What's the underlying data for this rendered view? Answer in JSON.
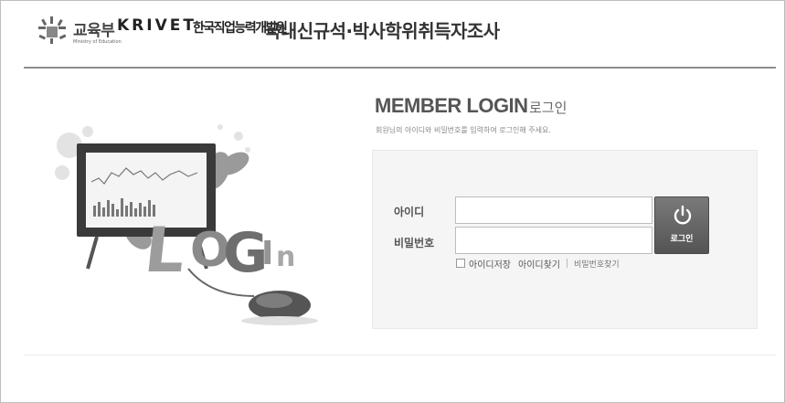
{
  "header": {
    "ministry_name": "교육부",
    "ministry_en": "Ministry of Education",
    "krivet_logo": "KRIVET",
    "krivet_kr": "한국직업능력개발원",
    "survey_title": "국내신규석·박사학위취득자조사"
  },
  "illustration": {
    "word": "LOGIN"
  },
  "login": {
    "title": "MEMBER LOGIN",
    "title_kr": "로그인",
    "description": "회원님의 아이디와 비밀번호를 입력하여 로그인해 주세요.",
    "id_label": "아이디",
    "pw_label": "비밀번호",
    "id_value": "",
    "pw_value": "",
    "button_label": "로그인",
    "save_id_label": "아이디저장",
    "find_id_label": "아이디찾기",
    "find_pw_label": "비밀번호찾기"
  },
  "icons": {
    "logo": "ministry-logo-icon",
    "power": "power-icon",
    "checkbox": "checkbox-icon"
  },
  "colors": {
    "header_line": "#8e8e8e",
    "button": "#5f5f5f",
    "box_bg": "#f5f5f5"
  }
}
